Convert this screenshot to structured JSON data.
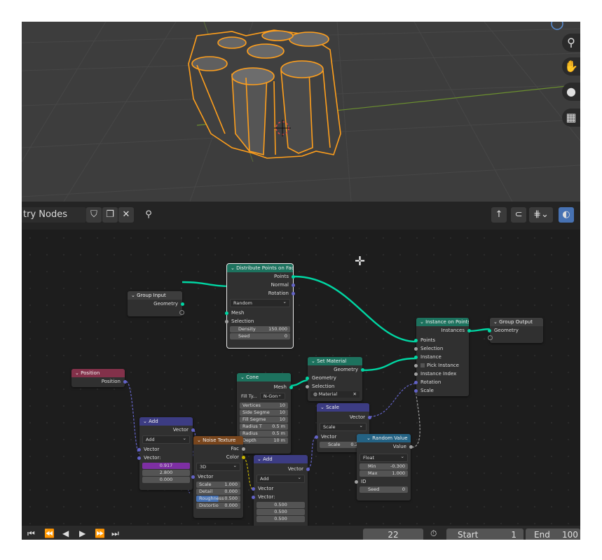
{
  "header": {
    "tree_name": "try Nodes",
    "fake_user_icon": "shield-icon",
    "duplicate_icon": "copy-icon",
    "unlink_icon": "close-icon",
    "pin_icon": "pin-icon",
    "parent_icon": "parent-arrow-icon",
    "snap_icon": "snap-icon",
    "overlay_icon": "overlay-icon"
  },
  "viewport": {
    "gizmos": [
      "zoom-icon",
      "pan-hand-icon",
      "camera-icon",
      "grid-icon"
    ]
  },
  "nodes": {
    "distribute": {
      "title": "Distribute Points on Face",
      "outputs": [
        "Points",
        "Normal",
        "Rotation"
      ],
      "mode": "Random",
      "inputs": [
        "Mesh",
        "Selection"
      ],
      "density_label": "Density",
      "density": "150.000",
      "seed_label": "Seed",
      "seed": "0"
    },
    "group_input": {
      "title": "Group Input",
      "output": "Geometry"
    },
    "instance": {
      "title": "Instance on Points",
      "output": "Instances",
      "inputs": [
        "Points",
        "Selection",
        "Instance"
      ],
      "pick": "Pick Instance",
      "inputs2": [
        "Instance Index",
        "Rotation",
        "Scale"
      ]
    },
    "group_output": {
      "title": "Group Output",
      "input": "Geometry"
    },
    "position": {
      "title": "Position",
      "output": "Position"
    },
    "cone": {
      "title": "Cone",
      "output": "Mesh",
      "fill_label": "Fill Ty...",
      "fill": "N-Gon",
      "rows": [
        {
          "label": "Vertices",
          "value": "10"
        },
        {
          "label": "Side Segme",
          "value": "10"
        },
        {
          "label": "Fill Segme",
          "value": "10"
        },
        {
          "label": "Radius T",
          "value": "0.5 m"
        },
        {
          "label": "Radius",
          "value": "0.5 m"
        },
        {
          "label": "Depth",
          "value": "10 m"
        }
      ]
    },
    "set_material": {
      "title": "Set Material",
      "output": "Geometry",
      "inputs": [
        "Geometry",
        "Selection"
      ],
      "material": "Material"
    },
    "scale": {
      "title": "Scale",
      "output": "Vector",
      "mode": "Scale",
      "input": "Vector",
      "scale_label": "Scale",
      "scale": "0.200"
    },
    "random": {
      "title": "Random Value",
      "output": "Value",
      "type": "Float",
      "min_label": "Min",
      "min": "-0.300",
      "max_label": "Max",
      "max": "1.000",
      "id_label": "ID",
      "seed_label": "Seed",
      "seed": "0"
    },
    "add1": {
      "title": "Add",
      "output": "Vector",
      "mode": "Add",
      "input": "Vector",
      "vec_label": "Vector:",
      "values": [
        "0.917",
        "2.800",
        "0.000"
      ]
    },
    "noise": {
      "title": "Noise Texture",
      "outputs": [
        "Fac",
        "Color"
      ],
      "dim": "3D",
      "input": "Vector",
      "rows": [
        {
          "label": "Scale",
          "value": "1.000"
        },
        {
          "label": "Detail",
          "value": "0.000"
        },
        {
          "label": "Roughness",
          "value": "0.500"
        },
        {
          "label": "Distortio",
          "value": "0.000"
        }
      ]
    },
    "add2": {
      "title": "Add",
      "output": "Vector",
      "mode": "Add",
      "input": "Vector",
      "vec_label": "Vector:",
      "values": [
        "0.500",
        "0.500",
        "0.500"
      ]
    }
  },
  "timeline": {
    "current_frame": "22",
    "start_label": "Start",
    "start": "1",
    "end_label": "End",
    "end": "100"
  },
  "colors": {
    "geometry_socket": "#00d6a3",
    "vector_socket": "#6363c7",
    "geometry_header": "#1d725e",
    "input_header": "#83314a",
    "vector_header": "#3c3c83",
    "texture_header": "#79461d",
    "converter_header": "#246283",
    "selection_outline": "#ff9f1c"
  }
}
